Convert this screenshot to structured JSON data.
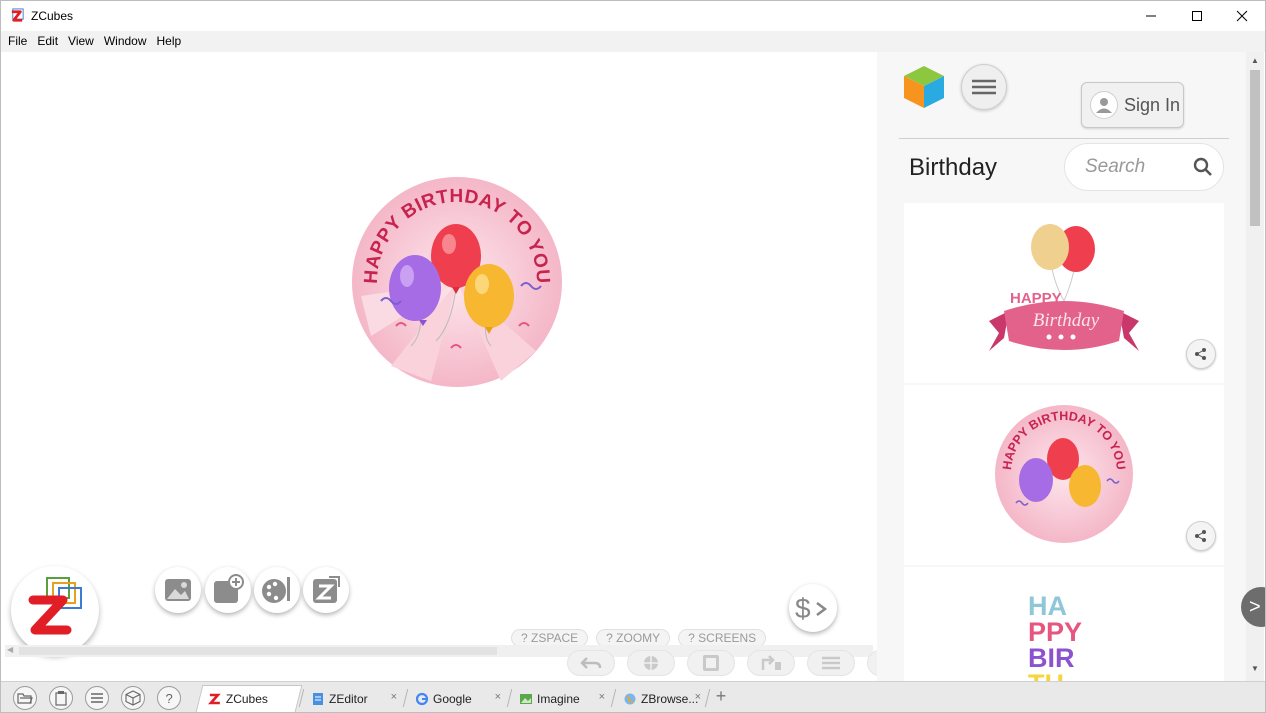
{
  "window": {
    "title": "ZCubes",
    "icon": "zcubes-z-icon",
    "controls": [
      "minimize-icon",
      "maximize-icon",
      "close-icon"
    ]
  },
  "menu": {
    "items": [
      "File",
      "Edit",
      "View",
      "Window",
      "Help"
    ]
  },
  "canvas": {
    "sticker": {
      "text": "HAPPY BIRTHDAY TO YOU"
    },
    "tools": [
      "image-edit-icon",
      "add-block-icon",
      "paint-palette-icon",
      "zcubes-edit-icon"
    ],
    "price_button_icon": "dollar-arrow-icon",
    "quick_links": [
      "? ZSPACE",
      "? ZOOMY",
      "? SCREENS"
    ],
    "nav_buttons": [
      "undo-icon",
      "web-icon",
      "frame-icon",
      "share-arrow-icon",
      "list-icon",
      "screen-icon"
    ]
  },
  "panel": {
    "sign_in": "Sign In",
    "category": "Birthday",
    "search_placeholder": "Search",
    "cards": [
      {
        "banner_small": "HAPPY",
        "banner_script": "Birthday"
      },
      {
        "sticker_text": "HAPPY BIRTHDAY TO YOU"
      },
      {
        "lines": [
          "HA",
          "PPY",
          "BIR",
          "TH"
        ]
      }
    ],
    "side_arrow": ">"
  },
  "taskbar": {
    "icons": [
      "folder-open-icon",
      "clipboard-icon",
      "menu-icon",
      "cube-icon",
      "help-icon"
    ],
    "tabs": [
      {
        "label": "ZCubes",
        "active": true
      },
      {
        "label": "ZEditor",
        "active": false
      },
      {
        "label": "Google",
        "active": false
      },
      {
        "label": "Imagine",
        "active": false
      },
      {
        "label": "ZBrowse...",
        "active": false
      }
    ],
    "close_glyph": "×",
    "new_tab": "+"
  },
  "colors": {
    "pink_light": "#f7c9d6",
    "pink": "#e5577f",
    "crimson": "#c8234f",
    "balloon_red": "#ef3f4f",
    "balloon_yellow": "#f7b731",
    "balloon_purple": "#a66ce6",
    "zcubes_red": "#e11d26"
  }
}
